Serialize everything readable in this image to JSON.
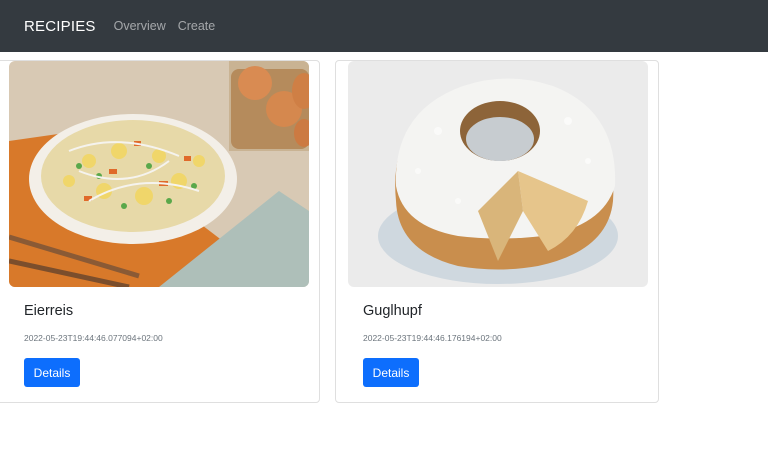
{
  "navbar": {
    "brand": "RECIPIES",
    "links": [
      "Overview",
      "Create"
    ]
  },
  "recipes": [
    {
      "title": "Eierreis",
      "date": "2022-05-23T19:44:46.077094+02:00",
      "button": "Details"
    },
    {
      "title": "Guglhupf",
      "date": "2022-05-23T19:44:46.176194+02:00",
      "button": "Details"
    }
  ],
  "colors": {
    "navbar": "#343a40",
    "button": "#0d6efd"
  }
}
